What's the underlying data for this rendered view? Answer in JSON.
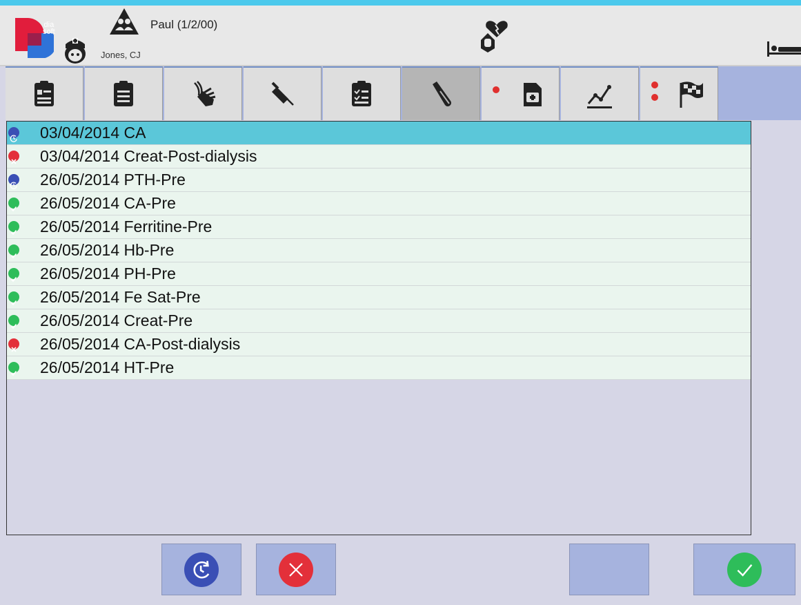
{
  "header": {
    "logo_text": "dia soft",
    "patient_name": "Paul (1/2/00)",
    "nurse_name": "Jones, CJ"
  },
  "tabs": [
    {
      "name": "patient-card-icon"
    },
    {
      "name": "clipboard-icon"
    },
    {
      "name": "hand-vessel-icon"
    },
    {
      "name": "syringe-icon"
    },
    {
      "name": "checklist-icon"
    },
    {
      "name": "test-tube-icon",
      "active": true
    },
    {
      "name": "medical-document-icon",
      "dots": 1
    },
    {
      "name": "trend-chart-icon"
    },
    {
      "name": "checkered-flag-icon",
      "dots": 2
    }
  ],
  "lab_orders": [
    {
      "label": "03/04/2014 CA",
      "status": "pending",
      "selected": true
    },
    {
      "label": "03/04/2014 Creat-Post-dialysis",
      "status": "cancelled"
    },
    {
      "label": "26/05/2014 PTH-Pre",
      "status": "pending"
    },
    {
      "label": "26/05/2014 CA-Pre",
      "status": "done"
    },
    {
      "label": "26/05/2014 Ferritine-Pre",
      "status": "done"
    },
    {
      "label": "26/05/2014 Hb-Pre",
      "status": "done"
    },
    {
      "label": "26/05/2014 PH-Pre",
      "status": "done"
    },
    {
      "label": "26/05/2014 Fe Sat-Pre",
      "status": "done"
    },
    {
      "label": "26/05/2014 Creat-Pre",
      "status": "done"
    },
    {
      "label": "26/05/2014 CA-Post-dialysis",
      "status": "cancelled"
    },
    {
      "label": "26/05/2014 HT-Pre",
      "status": "done"
    }
  ],
  "colors": {
    "accent_bar": "#4cc9ec",
    "pending": "#3a4fb5",
    "cancelled": "#e3303a",
    "done": "#2ebd5a",
    "selected_row": "#5bc7d9",
    "button_bg": "#a6b3de"
  },
  "buttons": [
    {
      "name": "reschedule-button",
      "icon": "clock-refresh-icon"
    },
    {
      "name": "cancel-button",
      "icon": "close-icon"
    },
    {
      "name": "blank-button",
      "icon": ""
    },
    {
      "name": "confirm-button",
      "icon": "check-icon"
    }
  ]
}
